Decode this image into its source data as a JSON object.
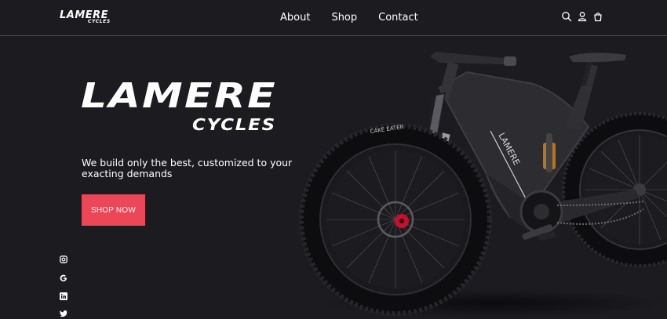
{
  "header": {
    "logo_top": "LAMERE",
    "logo_bottom": "CYCLES",
    "nav": [
      {
        "label": "About"
      },
      {
        "label": "Shop"
      },
      {
        "label": "Contact"
      }
    ],
    "icons": [
      "search-icon",
      "user-icon",
      "cart-icon"
    ]
  },
  "hero": {
    "title": "LAMERE",
    "subtitle": "CYCLES",
    "tagline": "We build only the best, customized to your exacting demands",
    "cta_label": "SHOP NOW"
  },
  "social": [
    "instagram-icon",
    "google-icon",
    "linkedin-icon",
    "twitter-icon"
  ],
  "frame_text": "LAMERE",
  "tire_text": "CAKE EATER",
  "colors": {
    "background": "#1c1b20",
    "accent": "#ec4757",
    "text": "#ffffff"
  }
}
